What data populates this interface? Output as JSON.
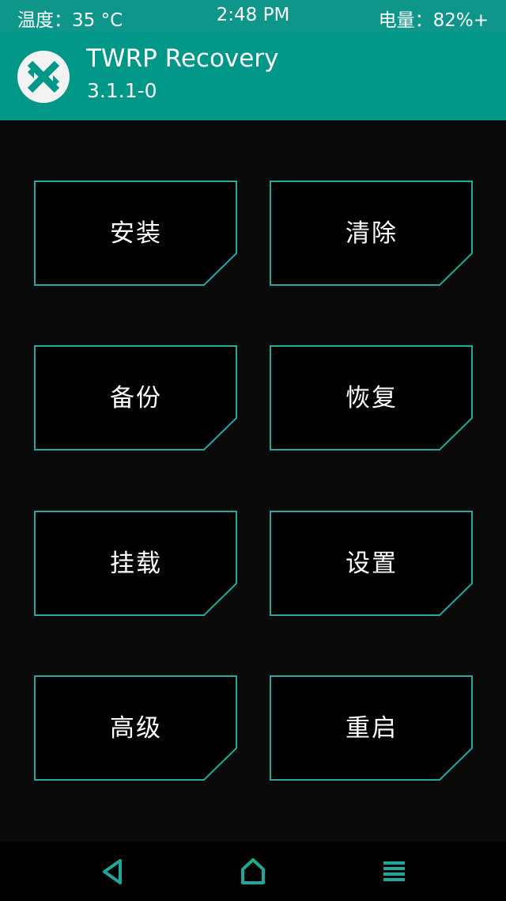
{
  "status_bar": {
    "temperature": "温度：35 °C",
    "time": "2:48 PM",
    "battery": "电量：82%+"
  },
  "header": {
    "title": "TWRP Recovery",
    "version": "3.1.1-0",
    "logo_icon": "twrp-logo-icon"
  },
  "menu": {
    "install": "安装",
    "wipe": "清除",
    "backup": "备份",
    "restore": "恢复",
    "mount": "挂载",
    "settings": "设置",
    "advanced": "高级",
    "reboot": "重启"
  },
  "nav": {
    "back_icon": "back-triangle-icon",
    "home_icon": "home-icon",
    "menu_icon": "menu-lines-icon"
  },
  "colors": {
    "accent": "#009688",
    "statusbar": "#0f968a",
    "button_border": "#24a8a0",
    "background": "#0a0a0a",
    "nav_icon": "#1ea79a"
  }
}
